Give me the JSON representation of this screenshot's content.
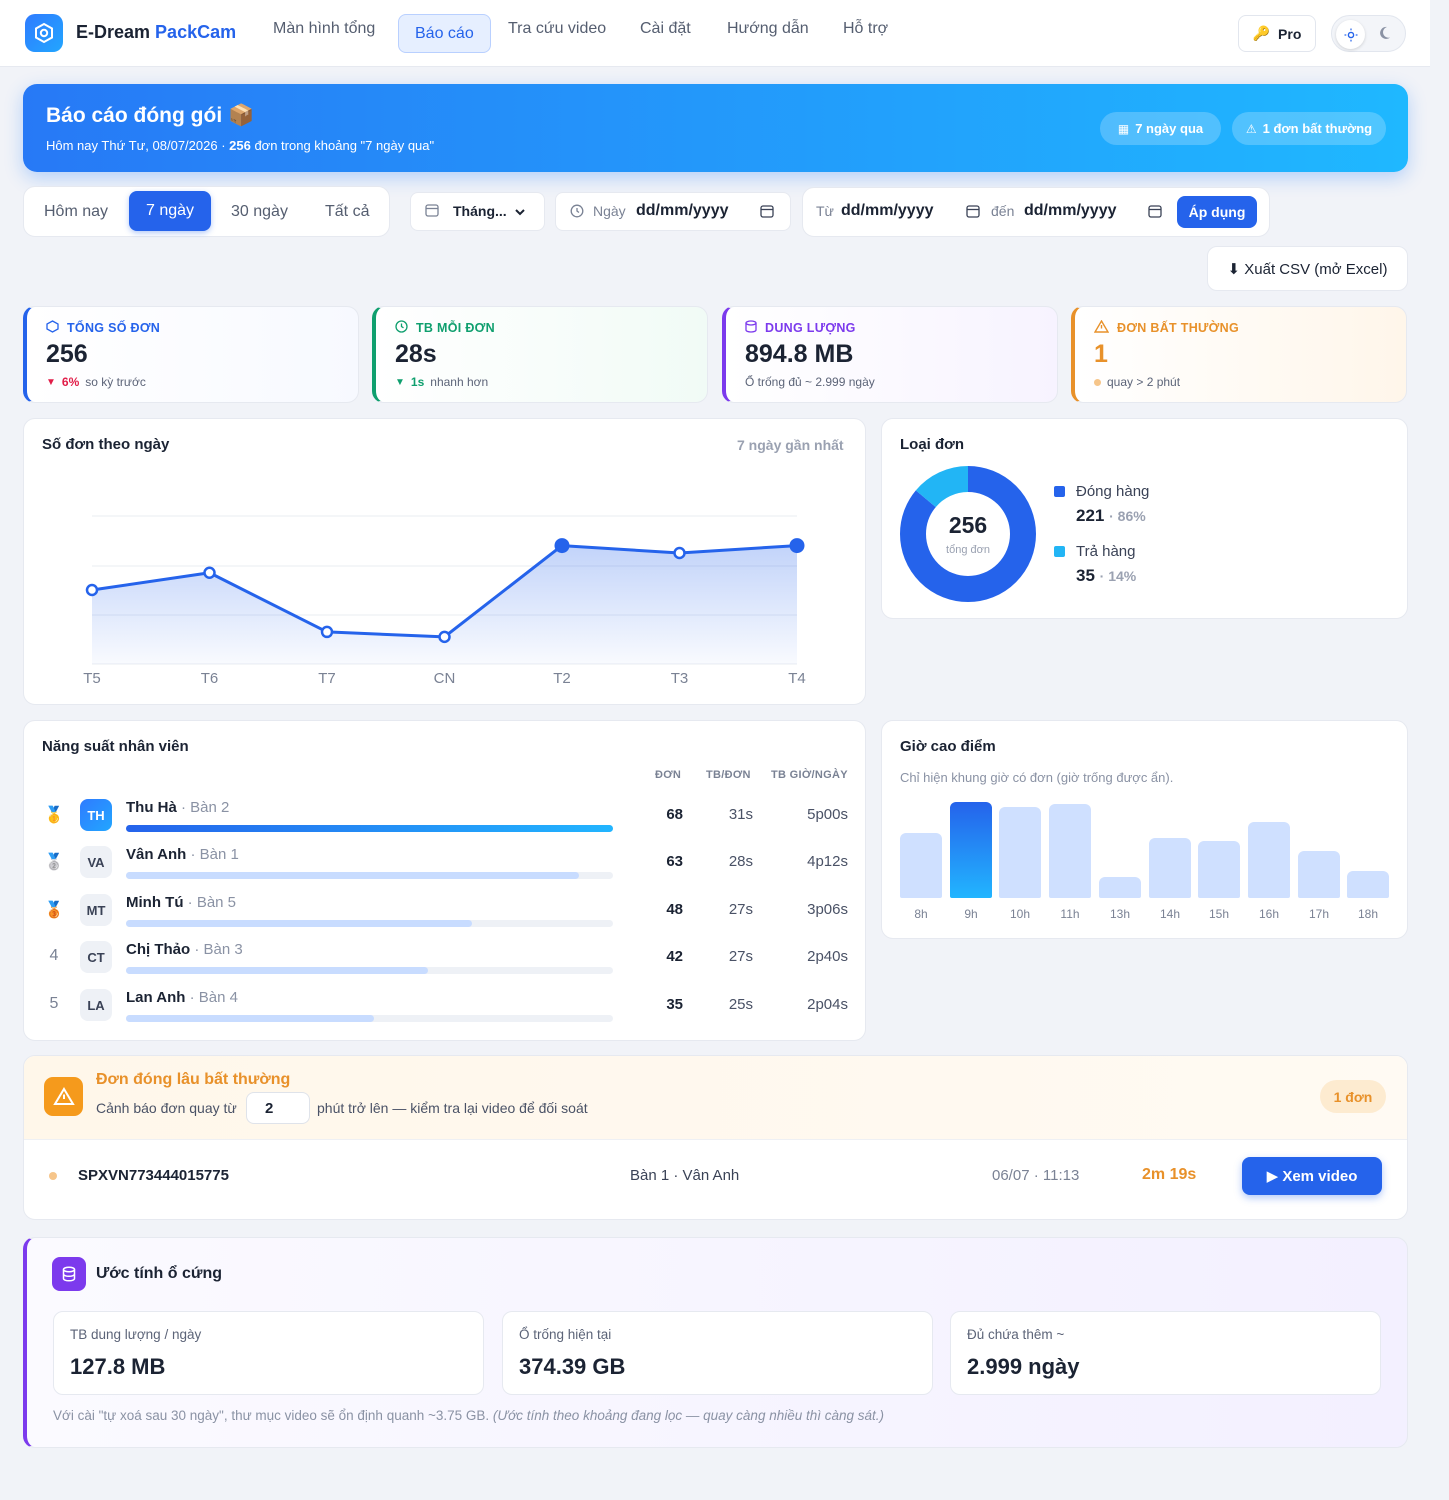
{
  "app": {
    "brand_a": "E-Dream",
    "brand_b": "PackCam"
  },
  "nav": [
    "Màn hình tổng",
    "Báo cáo",
    "Tra cứu video",
    "Cài đặt",
    "Hướng dẫn",
    "Hỗ trợ"
  ],
  "pro_label": "Pro",
  "hero": {
    "title": "Báo cáo đóng gói 📦",
    "sub_a": "Hôm nay Thứ Tư, 08/07/2026 · ",
    "sub_b": "256",
    "sub_c": " đơn trong khoảng \"7 ngày qua\"",
    "pill1": "7 ngày qua",
    "pill2": "1 đơn bất thường"
  },
  "range": {
    "options": [
      "Hôm nay",
      "7 ngày",
      "30 ngày",
      "Tất cả"
    ],
    "active": 1
  },
  "filters": {
    "month": "Tháng...",
    "day_label": "Ngày",
    "day_placeholder": "dd/mm/yyyy",
    "from_label": "Từ",
    "from_placeholder": "dd/mm/yyyy",
    "to_label": "đến",
    "to_placeholder": "dd/mm/yyyy",
    "apply": "Áp dụng",
    "export": "⬇ Xuất CSV (mở Excel)"
  },
  "kpis": [
    {
      "label": "TỔNG SỐ ĐƠN",
      "value": "256",
      "delta": "6%",
      "note": "so kỳ trước",
      "color": "#2563eb",
      "delta_color": "#e11d48"
    },
    {
      "label": "TB MỖI ĐƠN",
      "value": "28s",
      "delta": "1s",
      "note": "nhanh hơn",
      "color": "#0f9f6e",
      "delta_color": "#0f9f6e"
    },
    {
      "label": "DUNG LƯỢNG",
      "value": "894.8 MB",
      "note": "Ổ trống đủ ~ 2.999 ngày",
      "color": "#7c3aed"
    },
    {
      "label": "ĐƠN BẤT THƯỜNG",
      "value": "1",
      "note": "quay > 2 phút",
      "color": "#e8912a"
    }
  ],
  "daily": {
    "title": "Số đơn theo ngày",
    "range": "7 ngày gần nhất"
  },
  "chart_data": {
    "type": "area",
    "categories": [
      "T5",
      "T6",
      "T7",
      "CN",
      "T2",
      "T3",
      "T4"
    ],
    "values": [
      30,
      37,
      13,
      11,
      48,
      45,
      48
    ],
    "ylim": [
      0,
      60
    ],
    "grid": true
  },
  "types": {
    "title": "Loại đơn",
    "total": "256",
    "total_label": "tổng đơn",
    "items": [
      {
        "name": "Đóng hàng",
        "count": "221",
        "pct": "· 86%",
        "color": "#2563eb",
        "frac": 0.86
      },
      {
        "name": "Trả hàng",
        "count": "35",
        "pct": "· 14%",
        "color": "#22b5f5",
        "frac": 0.14
      }
    ]
  },
  "staff": {
    "title": "Năng suất nhân viên",
    "headers": [
      "ĐƠN",
      "TB/ĐƠN",
      "TB GIỜ/NGÀY"
    ],
    "rows": [
      {
        "rank": "🥇",
        "initials": "TH",
        "name": "Thu Hà",
        "desk": " · Bàn 2",
        "orders": "68",
        "avg": "31s",
        "hours": "5p00s",
        "frac": 1.0
      },
      {
        "rank": "🥈",
        "initials": "VA",
        "name": "Vân Anh",
        "desk": " · Bàn 1",
        "orders": "63",
        "avg": "28s",
        "hours": "4p12s",
        "frac": 0.93
      },
      {
        "rank": "🥉",
        "initials": "MT",
        "name": "Minh Tú",
        "desk": " · Bàn 5",
        "orders": "48",
        "avg": "27s",
        "hours": "3p06s",
        "frac": 0.71
      },
      {
        "rank": "4",
        "initials": "CT",
        "name": "Chị Thảo",
        "desk": " · Bàn 3",
        "orders": "42",
        "avg": "27s",
        "hours": "2p40s",
        "frac": 0.62
      },
      {
        "rank": "5",
        "initials": "LA",
        "name": "Lan Anh",
        "desk": " · Bàn 4",
        "orders": "35",
        "avg": "25s",
        "hours": "2p04s",
        "frac": 0.51
      }
    ]
  },
  "peak": {
    "title": "Giờ cao điểm",
    "note": "Chỉ hiện khung giờ có đơn (giờ trống được ẩn).",
    "hours": [
      "8h",
      "9h",
      "10h",
      "11h",
      "13h",
      "14h",
      "15h",
      "16h",
      "17h",
      "18h"
    ],
    "values": [
      66,
      98,
      93,
      96,
      21,
      61,
      58,
      78,
      48,
      28
    ],
    "highlight": 1
  },
  "anomaly": {
    "title": "Đơn đóng lâu bất thường",
    "desc_a": "Cảnh báo đơn quay từ",
    "threshold": "2",
    "desc_b": "phút trở lên — kiểm tra lại video để đối soát",
    "count": "1 đơn",
    "item": {
      "code": "SPXVN773444015775",
      "desk": "Bàn 1 · Vân Anh",
      "time": "06/07 · 11:13",
      "dur": "2m 19s",
      "action": "▶ Xem video"
    }
  },
  "disk": {
    "title": "Ước tính ổ cứng",
    "cards": [
      {
        "label": "TB dung lượng / ngày",
        "value": "127.8 MB"
      },
      {
        "label": "Ổ trống hiện tại",
        "value": "374.39 GB"
      },
      {
        "label": "Đủ chứa thêm ~",
        "value": "2.999 ngày"
      }
    ],
    "note_a": "Với cài \"tự xoá sau 30 ngày\", thư mục video sẽ ổn định quanh ~3.75 GB. ",
    "note_b": "(Ước tính theo khoảng đang lọc — quay càng nhiều thì càng sát.)"
  }
}
